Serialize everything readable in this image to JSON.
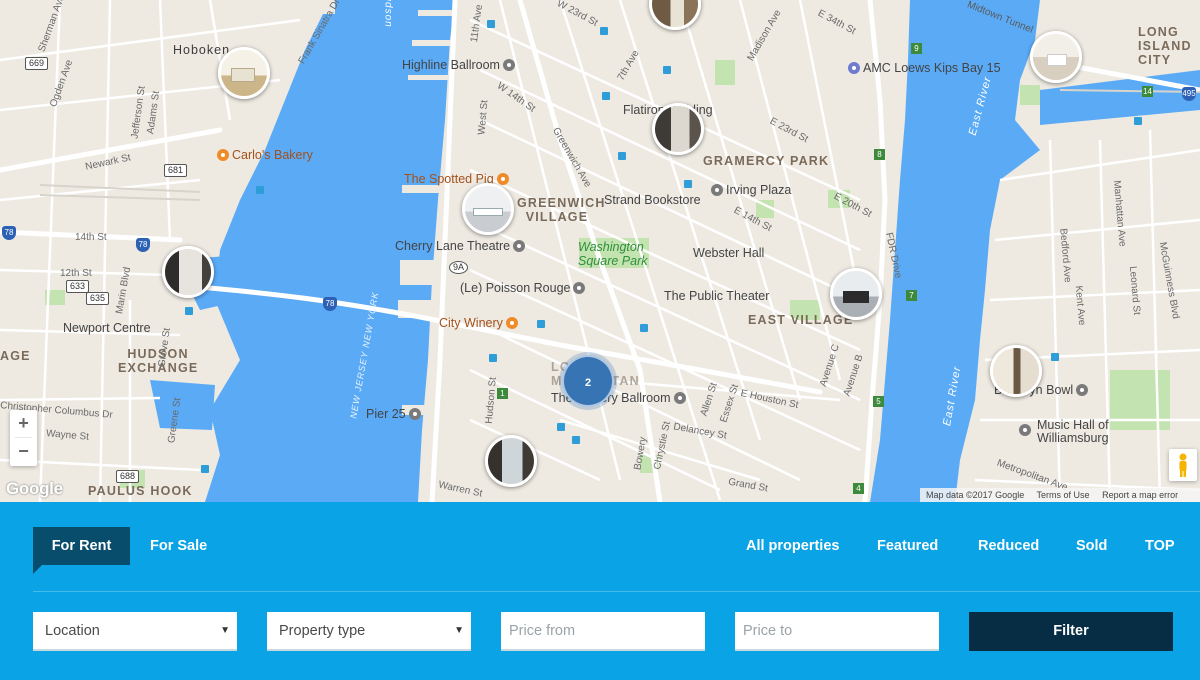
{
  "map": {
    "places": {
      "hoboken": "Hoboken",
      "highline_ballroom": "Highline Ballroom",
      "amc": "AMC Loews Kips Bay 15",
      "flatiron": "Flatiron Building",
      "carlos_bakery": "Carlo's Bakery",
      "gramercy": "GRAMERCY PARK",
      "spotted_pig": "The Spotted Pig",
      "greenwich_village": "GREENWICH VILLAGE",
      "strand": "Strand Bookstore",
      "irving_plaza": "Irving Plaza",
      "cherry_lane": "Cherry Lane Theatre",
      "washington_sq": "Washington Square Park",
      "webster_hall": "Webster Hall",
      "newport_centre": "Newport Centre",
      "poisson_rouge": "(Le) Poisson Rouge",
      "public_theater": "The Public Theater",
      "hudson_exchange": "HUDSON EXCHANGE",
      "city_winery": "City Winery",
      "east_village": "EAST VILLAGE",
      "lower_manhattan": "LOWER MANHATTAN",
      "bowery_ballroom": "The Bowery Ballroom",
      "pier25": "Pier 25",
      "bowl": "Brooklyn Bowl",
      "music_hall": "Music Hall of Williamsburg",
      "paulus_hook": "PAULUS HOOK",
      "long_island": "LONG ISLAND CITY",
      "age_fragment": "AGE",
      "east_river_1": "East River",
      "east_river_2": "East River",
      "nj_ny": "NEW JERSEY NEW YORK",
      "midtown_tunnel": "Midtown Tunnel",
      "hudson_river": "Hudson"
    },
    "streets": {
      "newark_st": "Newark St",
      "14th_st": "14th St",
      "12th_st": "12th St",
      "w14th": "W 14th St",
      "e14th": "E 14th St",
      "e20th": "E 20th St",
      "e23rd": "E 23rd St",
      "e34th": "E 34th St",
      "w23rd": "W 23rd St",
      "madison": "Madison Ave",
      "7th_ave": "7th Ave",
      "fdr": "FDR Drive",
      "houston": "E Houston St",
      "grand": "Grand St",
      "warren": "Warren St",
      "hudson_st": "Hudson St",
      "christopher": "Christopher Columbus Dr",
      "wayne": "Wayne St",
      "marin": "Marin Blvd",
      "jefferson": "Jefferson St",
      "adams": "Adams St",
      "grove": "Grove St",
      "greene": "Greene St",
      "manhattan_ave": "Manhattan Ave",
      "mcguinness": "McGuinness Blvd",
      "leonard": "Leonard St",
      "metropolitan": "Metropolitan Ave",
      "ogden": "Ogden Ave",
      "sherman": "Sherman Ave",
      "franklin": "Frank Sinatra Dr",
      "avenue_c": "Avenue C",
      "avenue_b": "Avenue B",
      "bowery": "Bowery",
      "chrystie": "Chrystie St",
      "delancey": "Delancey St",
      "essex": "Essex St",
      "allen": "Allen St",
      "greenwich_ave": "Greenwich Ave",
      "11th_ave": "11th Ave",
      "west_st": "West St",
      "bedford": "Bedford Ave",
      "kent": "Kent Ave"
    },
    "shields": {
      "r669": "669",
      "r681": "681",
      "r633": "633",
      "r635": "635",
      "r688": "688",
      "r78a": "78",
      "r78b": "78",
      "r78c": "78",
      "r9a": "9A",
      "r495": "495",
      "g9": "9",
      "g8": "8",
      "g7": "7",
      "g5": "5",
      "g4": "4",
      "g1": "1",
      "g14": "14"
    },
    "cluster_count": "2",
    "controls": {
      "zoom_in": "+",
      "zoom_out": "−",
      "google": "Google",
      "map_data": "Map data ©2017 Google",
      "terms": "Terms of Use",
      "report": "Report a map error"
    },
    "colors": {
      "water": "#5aaaf6",
      "land": "#eeeae2",
      "park": "#c3e3b0",
      "cluster": "#3774b4"
    }
  },
  "panel": {
    "tabs": {
      "for_rent": "For Rent",
      "for_sale": "For Sale"
    },
    "links": {
      "all": "All properties",
      "featured": "Featured",
      "reduced": "Reduced",
      "sold": "Sold",
      "top": "TOP"
    },
    "fields": {
      "location": "Location",
      "property_type": "Property type",
      "price_from_placeholder": "Price from",
      "price_to_placeholder": "Price to"
    },
    "filter_button": "Filter",
    "colors": {
      "background": "#0aa3e5",
      "active_tab": "#084d6b",
      "button": "#062d44"
    }
  }
}
